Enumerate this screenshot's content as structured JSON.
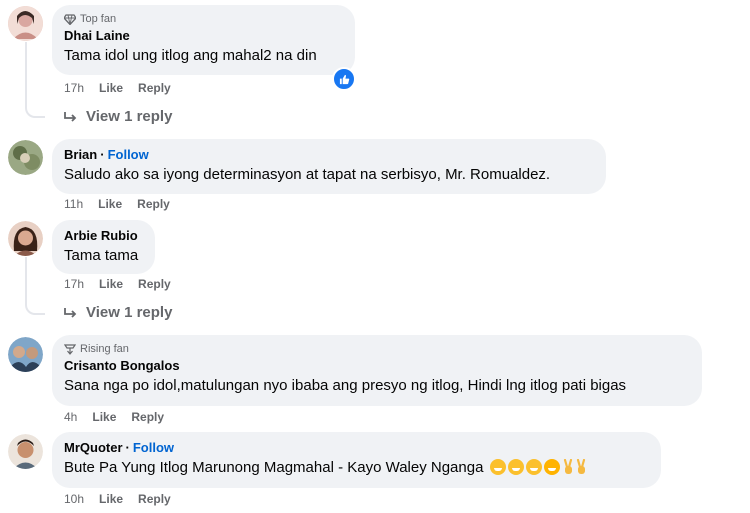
{
  "comments": [
    {
      "badge": "Top fan",
      "name": "Dhai Laine",
      "text": "Tama idol ung itlog ang mahal2 na din",
      "time": "17h",
      "like": "Like",
      "reply": "Reply",
      "view_replies": "View 1 reply",
      "avatar_color": "#d9a7a0"
    },
    {
      "name": "Brian",
      "follow": "Follow",
      "text": "Saludo ako sa iyong determinasyon at tapat na serbisyo, Mr. Romualdez.",
      "time": "11h",
      "like": "Like",
      "reply": "Reply",
      "avatar_color": "#6b7d5a"
    },
    {
      "name": "Arbie Rubio",
      "text": "Tama tama",
      "time": "17h",
      "like": "Like",
      "reply": "Reply",
      "view_replies": "View 1 reply",
      "avatar_color": "#8a5a4a"
    },
    {
      "badge": "Rising fan",
      "name": "Crisanto Bongalos",
      "text": "Sana nga po idol,matulungan nyo ibaba ang presyo ng itlog, Hindi lng itlog pati bigas",
      "time": "4h",
      "like": "Like",
      "reply": "Reply",
      "avatar_color": "#3d5a78"
    },
    {
      "name": "MrQuoter",
      "follow": "Follow",
      "text": "Bute Pa Yung Itlog Marunong Magmahal - Kayo Waley Nganga",
      "time": "10h",
      "like": "Like",
      "reply": "Reply",
      "avatar_color": "#b07860"
    }
  ],
  "colors": {
    "bubble": "#f0f2f5",
    "link": "#0064d1",
    "meta": "#65676b",
    "reaction": "#1877f2"
  },
  "icons": [
    "top-fan-diamond-icon",
    "rising-fan-icon",
    "like-reaction-icon",
    "reply-arrow-icon",
    "grin-emoji-icon",
    "peace-hand-icon"
  ]
}
